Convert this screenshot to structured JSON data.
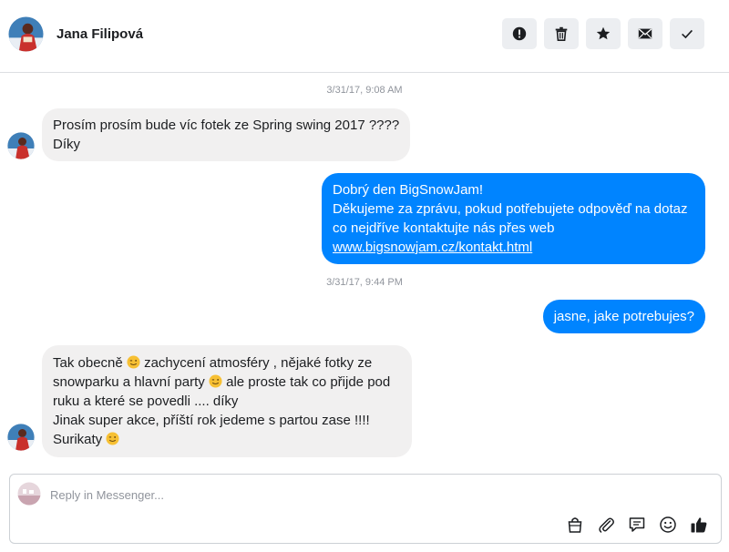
{
  "header": {
    "contact_name": "Jana Filipová",
    "actions": [
      {
        "icon": "alert-icon"
      },
      {
        "icon": "trash-icon"
      },
      {
        "icon": "star-icon"
      },
      {
        "icon": "mail-icon"
      },
      {
        "icon": "check-icon"
      }
    ]
  },
  "thread": {
    "timestamps": [
      "3/31/17, 9:08 AM",
      "3/31/17, 9:44 PM"
    ],
    "messages": [
      {
        "from": "them",
        "line1": "Prosím prosím bude víc fotek ze Spring swing 2017 ????",
        "line2": "Díky"
      },
      {
        "from": "me",
        "line1": "Dobrý den BigSnowJam!",
        "line2": "Děkujeme za zprávu, pokud potřebujete odpověď na dotaz",
        "line3": "co nejdříve kontaktujte nás přes web",
        "link": "www.bigsnowjam.cz/kontakt.html"
      },
      {
        "from": "me",
        "text": "jasne, jake potrebujes?"
      },
      {
        "from": "them",
        "p1": "Tak obecně",
        "p2": " zachycení atmosféry , nějaké fotky ze",
        "p3": "snowparku a hlavní party",
        "p4": " ale proste tak co přijde pod",
        "p5": "ruku a které se povedli .... díky",
        "p6": "Jinak super akce, příští rok jedeme s partou zase !!!!",
        "p7": "Surikaty"
      }
    ]
  },
  "composer": {
    "placeholder": "Reply in Messenger...",
    "tools": [
      "bag-icon",
      "attachment-icon",
      "saved-reply-icon",
      "emoji-icon",
      "thumbs-up-icon"
    ]
  },
  "colors": {
    "outgoing_bubble": "#0084ff",
    "incoming_bubble": "#f1f0f0",
    "action_button_bg": "#eceef1"
  }
}
